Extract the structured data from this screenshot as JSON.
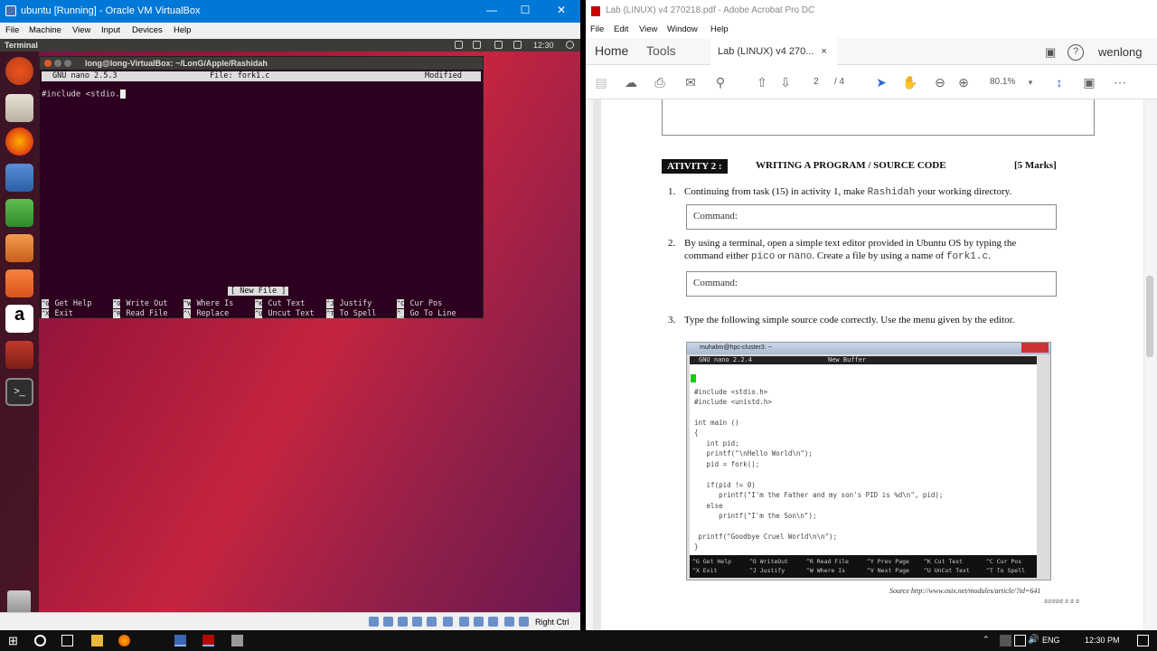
{
  "vbox": {
    "title": "ubuntu [Running] - Oracle VM VirtualBox",
    "menu": [
      "File",
      "Machine",
      "View",
      "Input",
      "Devices",
      "Help"
    ],
    "status_right": "Right Ctrl"
  },
  "ubuntu": {
    "topbar_label": "Terminal",
    "clock": "12:30",
    "launcher": [
      "ubuntu-dash-icon",
      "files-icon",
      "firefox-icon",
      "writer-icon",
      "calc-icon",
      "impress-icon",
      "software-center-icon",
      "amazon-icon",
      "settings-icon",
      "terminal-icon"
    ]
  },
  "terminal": {
    "title": "long@long-VirtualBox: ~/LonG/Apple/Rashidah",
    "nano_version": "GNU nano 2.5.3",
    "nano_file": "File: fork1.c",
    "nano_state": "Modified",
    "line1": "#include <stdio.",
    "status": "[ New File ]",
    "shortcuts": [
      {
        "key": "^G",
        "label": "Get Help"
      },
      {
        "key": "^O",
        "label": "Write Out"
      },
      {
        "key": "^W",
        "label": "Where Is"
      },
      {
        "key": "^K",
        "label": "Cut Text"
      },
      {
        "key": "^J",
        "label": "Justify"
      },
      {
        "key": "^C",
        "label": "Cur Pos"
      },
      {
        "key": "^X",
        "label": "Exit"
      },
      {
        "key": "^R",
        "label": "Read File"
      },
      {
        "key": "^\\",
        "label": "Replace"
      },
      {
        "key": "^U",
        "label": "Uncut Text"
      },
      {
        "key": "^T",
        "label": "To Spell"
      },
      {
        "key": "^_",
        "label": "Go To Line"
      }
    ]
  },
  "acrobat": {
    "title": "Lab (LINUX) v4 270218.pdf - Adobe Acrobat Pro DC",
    "menu": [
      "File",
      "Edit",
      "View",
      "Window",
      "Help"
    ],
    "tab_home": "Home",
    "tab_tools": "Tools",
    "doc_tab": "Lab (LINUX) v4 270...",
    "user": "wenlong",
    "page_current": "2",
    "page_total": "/ 4",
    "zoom": "80.1%"
  },
  "pdf": {
    "activity_badge": "ATIVITY 2 :",
    "activity_title": "WRITING A PROGRAM / SOURCE CODE",
    "activity_marks": "[5 Marks]",
    "q1_num": "1.",
    "q1_a": "Continuing from task (15) in activity 1, make ",
    "q1_mono": "Rashidah",
    "q1_b": " your working directory.",
    "q2_num": "2.",
    "q2_line1": "By using a terminal, open a simple text editor provided in Ubuntu OS by typing the",
    "q2_a": "command either ",
    "q2_m1": "pico",
    "q2_b": " or ",
    "q2_m2": "nano",
    "q2_c": ". Create a file by using a name of ",
    "q2_m3": "fork1.c",
    "q2_d": ".",
    "q3_num": "3.",
    "q3_text": "Type the following simple source code correctly. Use the menu given by the editor.",
    "command_label": "Command:",
    "shot_title": "muhalim@hpc-cluster3: ~",
    "shot_nano": "GNU nano 2.2.4",
    "shot_buffer": "New Buffer",
    "code": [
      "#include <stdio.h>",
      "#include <unistd.h>",
      "",
      "int main ()",
      "{",
      "   int pid;",
      "   printf(\"\\nHello World\\n\");",
      "   pid = fork();",
      "",
      "   if(pid != 0)",
      "      printf(\"I'm the Father and my son's PID is %d\\n\", pid);",
      "   else",
      "      printf(\"I'm the Son\\n\");",
      "",
      " printf(\"Goodbye Cruel World\\n\\n\");",
      "}"
    ],
    "shot_shortcuts": [
      "^G Get Help",
      "^O WriteOut",
      "^R Read File",
      "^Y Prev Page",
      "^K Cut Text",
      "^C Cur Pos",
      "^X Exit",
      "^J Justify",
      "^W Where Is",
      "^V Next Page",
      "^U UnCut Text",
      "^T To Spell"
    ],
    "source": "Source  http://www.osix.net/modules/article/?id=641",
    "source2": "₪₪₪₪₪ ₪ ₪ ₪"
  },
  "taskbar": {
    "lang": "ENG",
    "time": "12:30 PM"
  }
}
